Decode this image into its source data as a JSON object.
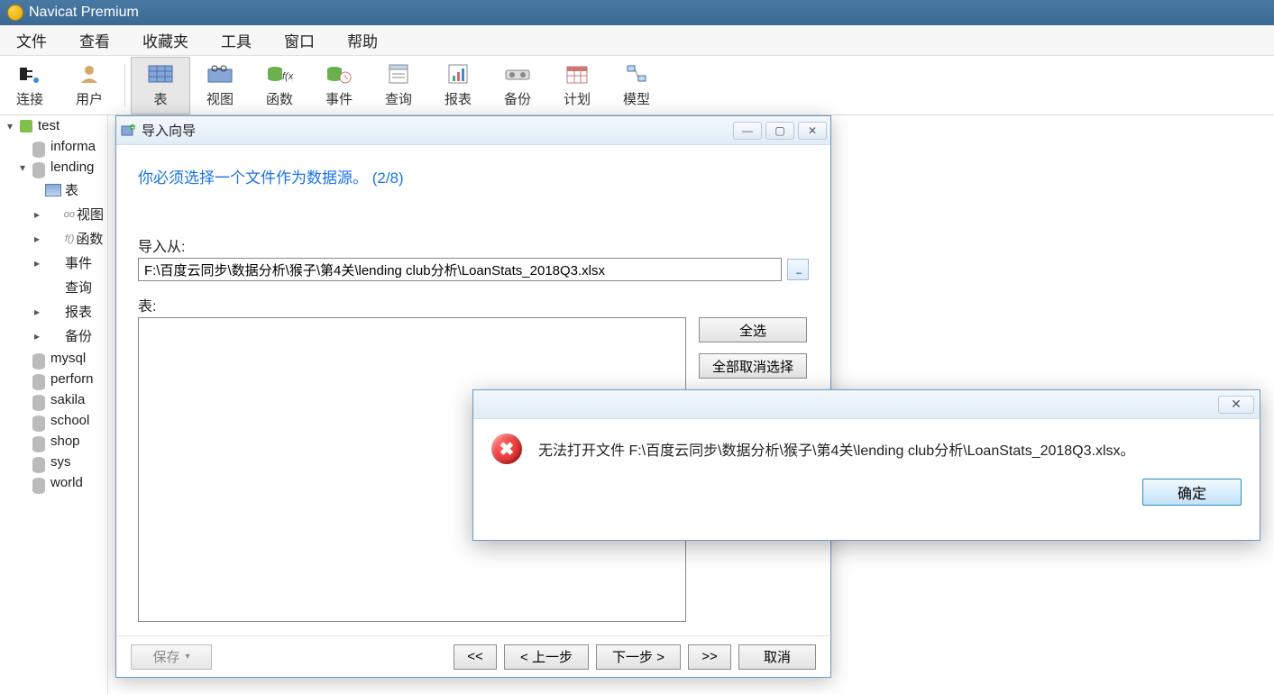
{
  "app": {
    "title": "Navicat Premium"
  },
  "menu": {
    "items": [
      "文件",
      "查看",
      "收藏夹",
      "工具",
      "窗口",
      "帮助"
    ]
  },
  "toolbar": {
    "items": [
      {
        "label": "连接",
        "icon": "plug"
      },
      {
        "label": "用户",
        "icon": "user"
      },
      {
        "label": "表",
        "icon": "table",
        "active": true
      },
      {
        "label": "视图",
        "icon": "view"
      },
      {
        "label": "函数",
        "icon": "fx"
      },
      {
        "label": "事件",
        "icon": "event"
      },
      {
        "label": "查询",
        "icon": "query"
      },
      {
        "label": "报表",
        "icon": "report"
      },
      {
        "label": "备份",
        "icon": "backup"
      },
      {
        "label": "计划",
        "icon": "schedule"
      },
      {
        "label": "模型",
        "icon": "model"
      }
    ]
  },
  "sidebar": {
    "items": [
      {
        "label": "test",
        "depth": 1,
        "arrow": "▾",
        "icon": "conn"
      },
      {
        "label": "informa",
        "depth": 2,
        "arrow": "",
        "icon": "db"
      },
      {
        "label": "lending",
        "depth": 2,
        "arrow": "▾",
        "icon": "db"
      },
      {
        "label": "表",
        "depth": 3,
        "arrow": "",
        "icon": "table"
      },
      {
        "label": "视图",
        "depth": 3,
        "arrow": "▸",
        "icon": "view",
        "prefix": "oo"
      },
      {
        "label": "函数",
        "depth": 3,
        "arrow": "▸",
        "icon": "fx",
        "prefix": "f()"
      },
      {
        "label": "事件",
        "depth": 3,
        "arrow": "▸",
        "icon": "event"
      },
      {
        "label": "查询",
        "depth": 3,
        "arrow": "",
        "icon": "query"
      },
      {
        "label": "报表",
        "depth": 3,
        "arrow": "▸",
        "icon": "report"
      },
      {
        "label": "备份",
        "depth": 3,
        "arrow": "▸",
        "icon": "backup"
      },
      {
        "label": "mysql",
        "depth": 2,
        "arrow": "",
        "icon": "db"
      },
      {
        "label": "perforn",
        "depth": 2,
        "arrow": "",
        "icon": "db"
      },
      {
        "label": "sakila",
        "depth": 2,
        "arrow": "",
        "icon": "db"
      },
      {
        "label": "school",
        "depth": 2,
        "arrow": "",
        "icon": "db"
      },
      {
        "label": "shop",
        "depth": 2,
        "arrow": "",
        "icon": "db"
      },
      {
        "label": "sys",
        "depth": 2,
        "arrow": "",
        "icon": "db"
      },
      {
        "label": "world",
        "depth": 2,
        "arrow": "",
        "icon": "db"
      }
    ]
  },
  "wizard": {
    "title": "导入向导",
    "hint": "你必须选择一个文件作为数据源。 (2/8)",
    "import_from_label": "导入从:",
    "import_from_value": "F:\\百度云同步\\数据分析\\猴子\\第4关\\lending club分析\\LoanStats_2018Q3.xlsx",
    "table_label": "表:",
    "select_all": "全选",
    "deselect_all": "全部取消选择",
    "save": "保存",
    "first": "<<",
    "prev": "< 上一步",
    "next": "下一步 >",
    "last": ">>",
    "cancel": "取消"
  },
  "error": {
    "message": "无法打开文件 F:\\百度云同步\\数据分析\\猴子\\第4关\\lending club分析\\LoanStats_2018Q3.xlsx。",
    "ok": "确定"
  }
}
